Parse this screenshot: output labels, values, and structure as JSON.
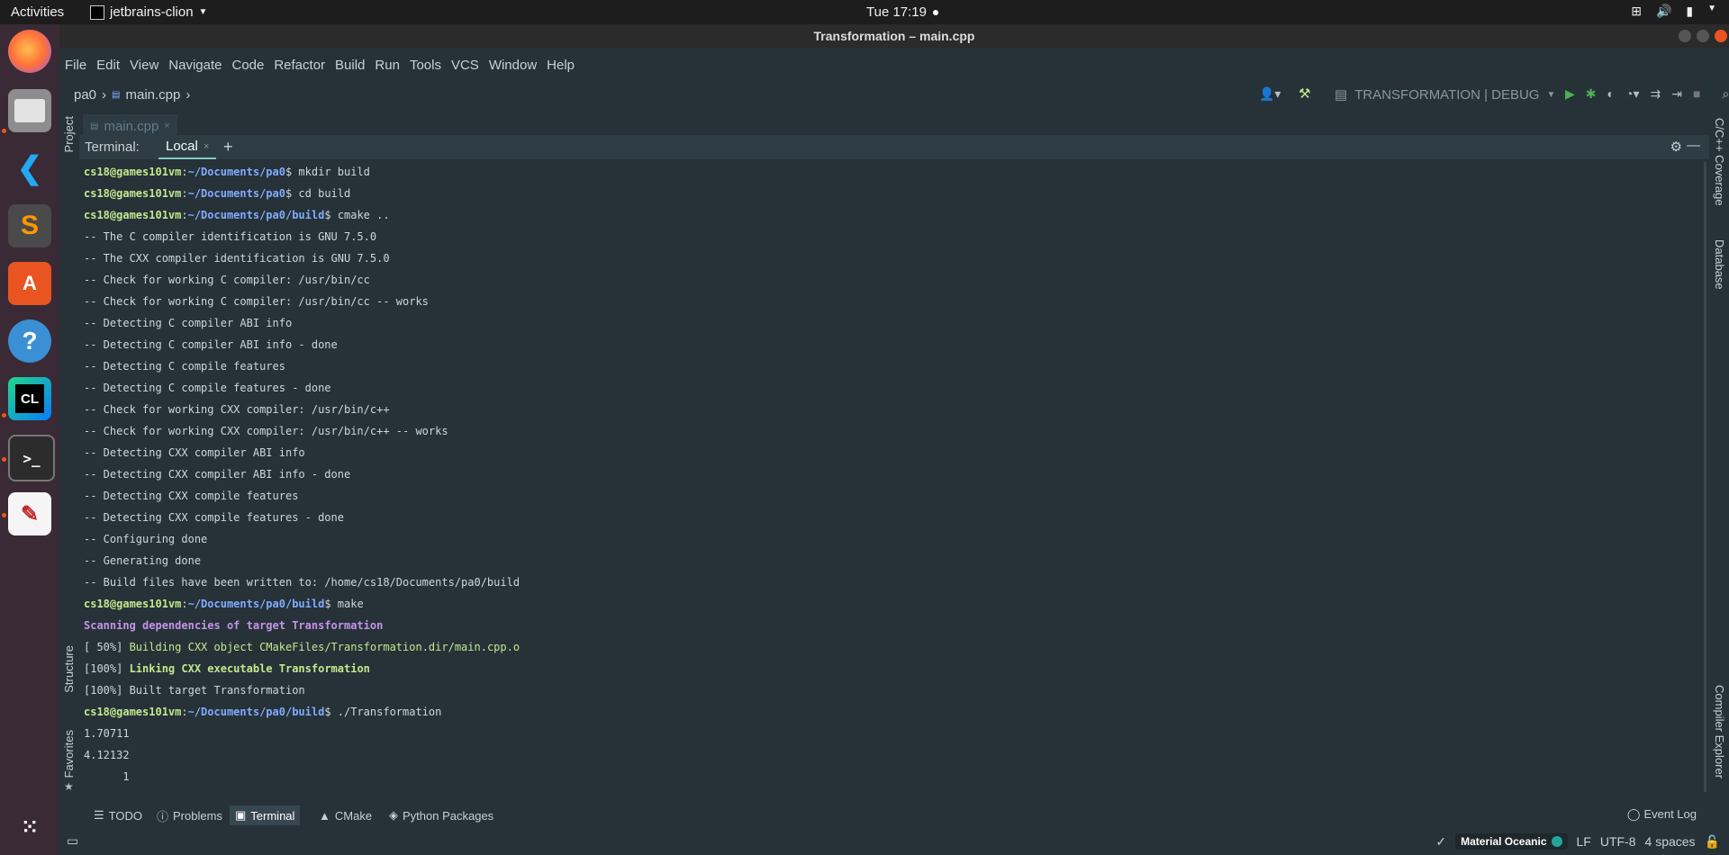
{
  "topbar": {
    "activities": "Activities",
    "app_name": "jetbrains-clion",
    "clock": "Tue 17:19"
  },
  "dock": {
    "items": [
      {
        "name": "firefox",
        "glyph": ""
      },
      {
        "name": "files",
        "glyph": ""
      },
      {
        "name": "vscode",
        "glyph": ""
      },
      {
        "name": "sublime-text",
        "glyph": ""
      },
      {
        "name": "software-center",
        "glyph": "A"
      },
      {
        "name": "help",
        "glyph": "?"
      },
      {
        "name": "clion",
        "glyph": "CL"
      },
      {
        "name": "terminal",
        "glyph": ">_"
      },
      {
        "name": "text-editor",
        "glyph": ""
      }
    ]
  },
  "window": {
    "title": "Transformation – main.cpp"
  },
  "menu": [
    "File",
    "Edit",
    "View",
    "Navigate",
    "Code",
    "Refactor",
    "Build",
    "Run",
    "Tools",
    "VCS",
    "Window",
    "Help"
  ],
  "nav": {
    "project": "pa0",
    "file": "main.cpp",
    "run_config": "TRANSFORMATION | DEBUG"
  },
  "left_panels": {
    "project": "Project",
    "structure": "Structure",
    "favorites": "Favorites"
  },
  "right_panels": {
    "coverage": "C/C++ Coverage",
    "database": "Database",
    "compiler_explorer": "Compiler Explorer"
  },
  "editor_tab": "main.cpp",
  "terminal": {
    "label": "Terminal:",
    "tab": "Local",
    "lines": [
      {
        "kind": "prompt",
        "user": "cs18@games101vm",
        "path": "~/Documents/pa0",
        "cmd": "$ mkdir build"
      },
      {
        "kind": "prompt",
        "user": "cs18@games101vm",
        "path": "~/Documents/pa0",
        "cmd": "$ cd build"
      },
      {
        "kind": "prompt",
        "user": "cs18@games101vm",
        "path": "~/Documents/pa0/build",
        "cmd": "$ cmake .."
      },
      {
        "kind": "text",
        "text": "-- The C compiler identification is GNU 7.5.0"
      },
      {
        "kind": "text",
        "text": "-- The CXX compiler identification is GNU 7.5.0"
      },
      {
        "kind": "text",
        "text": "-- Check for working C compiler: /usr/bin/cc"
      },
      {
        "kind": "text",
        "text": "-- Check for working C compiler: /usr/bin/cc -- works"
      },
      {
        "kind": "text",
        "text": "-- Detecting C compiler ABI info"
      },
      {
        "kind": "text",
        "text": "-- Detecting C compiler ABI info - done"
      },
      {
        "kind": "text",
        "text": "-- Detecting C compile features"
      },
      {
        "kind": "text",
        "text": "-- Detecting C compile features - done"
      },
      {
        "kind": "text",
        "text": "-- Check for working CXX compiler: /usr/bin/c++"
      },
      {
        "kind": "text",
        "text": "-- Check for working CXX compiler: /usr/bin/c++ -- works"
      },
      {
        "kind": "text",
        "text": "-- Detecting CXX compiler ABI info"
      },
      {
        "kind": "text",
        "text": "-- Detecting CXX compiler ABI info - done"
      },
      {
        "kind": "text",
        "text": "-- Detecting CXX compile features"
      },
      {
        "kind": "text",
        "text": "-- Detecting CXX compile features - done"
      },
      {
        "kind": "text",
        "text": "-- Configuring done"
      },
      {
        "kind": "text",
        "text": "-- Generating done"
      },
      {
        "kind": "text",
        "text": "-- Build files have been written to: /home/cs18/Documents/pa0/build"
      },
      {
        "kind": "prompt",
        "user": "cs18@games101vm",
        "path": "~/Documents/pa0/build",
        "cmd": "$ make"
      },
      {
        "kind": "purple",
        "text": "Scanning dependencies of target Transformation"
      },
      {
        "kind": "progress",
        "pct": "[ 50%]",
        "text": " Building CXX object CMakeFiles/Transformation.dir/main.cpp.o"
      },
      {
        "kind": "progress-bold",
        "pct": "[100%]",
        "text": " Linking CXX executable Transformation"
      },
      {
        "kind": "text",
        "text": "[100%] Built target Transformation"
      },
      {
        "kind": "prompt",
        "user": "cs18@games101vm",
        "path": "~/Documents/pa0/build",
        "cmd": "$ ./Transformation"
      },
      {
        "kind": "text",
        "text": "1.70711"
      },
      {
        "kind": "text",
        "text": "4.12132"
      },
      {
        "kind": "text",
        "text": "      1"
      }
    ]
  },
  "bottom_tabs": [
    "TODO",
    "Problems",
    "Terminal",
    "CMake",
    "Python Packages"
  ],
  "event_log": "Event Log",
  "status": {
    "theme": "Material Oceanic",
    "line_sep": "LF",
    "encoding": "UTF-8",
    "indent": "4 spaces"
  },
  "colors": {
    "accent": "#80cbc4",
    "prompt_user": "#c3e88d",
    "prompt_path": "#82aaff",
    "scan_text": "#c792ea",
    "background": "#263238"
  }
}
